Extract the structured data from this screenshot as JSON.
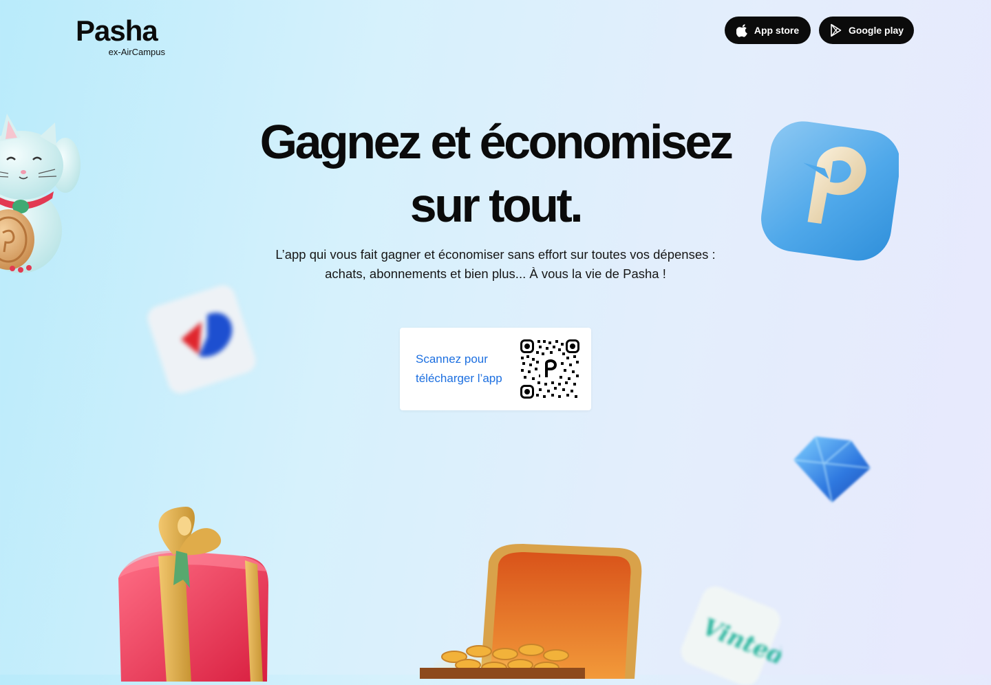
{
  "header": {
    "logo_text": "Pasha",
    "logo_subtitle": "ex-AirCampus",
    "app_store_label": "App store",
    "google_play_label": "Google play"
  },
  "hero": {
    "title_line1": "Gagnez et économisez",
    "title_line2": "sur tout.",
    "subtitle_line1": "L’app qui vous fait gagner et économiser sans effort sur toutes vos dépenses :",
    "subtitle_line2": "achats, abonnements et bien plus... À vous la vie de Pasha !"
  },
  "qr_card": {
    "text_line1": "Scannez pour",
    "text_line2": "télécharger l’app"
  },
  "decorations": {
    "carrefour_tile": "carrefour-logo-icon",
    "vinted_tile_text": "Vinted",
    "p_icon": "pasha-app-icon",
    "cat": "lucky-cat-icon",
    "gem": "gem-icon",
    "gift": "gift-box-icon",
    "chest": "treasure-chest-icon"
  },
  "colors": {
    "text": "#0b0b0b",
    "button_bg": "#0b0b0b",
    "button_text": "#ffffff",
    "link_blue": "#1c6fe0",
    "vinted_green": "#2fb7a0"
  }
}
